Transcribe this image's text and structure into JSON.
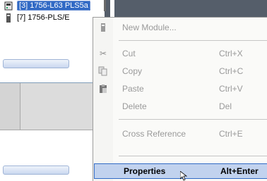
{
  "tree": {
    "items": [
      {
        "label": "[3] 1756-L63 PLS5a"
      },
      {
        "label": "[7] 1756-PLS/E"
      }
    ]
  },
  "context_menu": {
    "items": [
      {
        "label": "New Module...",
        "shortcut": "",
        "icon": "module-icon",
        "disabled": true
      },
      {
        "label": "Cut",
        "shortcut": "Ctrl+X",
        "icon": "scissors-icon",
        "disabled": true
      },
      {
        "label": "Copy",
        "shortcut": "Ctrl+C",
        "icon": "copy-icon",
        "disabled": true
      },
      {
        "label": "Paste",
        "shortcut": "Ctrl+V",
        "icon": "clipboard-icon",
        "disabled": true
      },
      {
        "label": "Delete",
        "shortcut": "Del",
        "icon": "",
        "disabled": true
      },
      {
        "label": "Cross Reference",
        "shortcut": "Ctrl+E",
        "icon": "",
        "disabled": true
      },
      {
        "label": "Properties",
        "shortcut": "Alt+Enter",
        "icon": "",
        "disabled": false,
        "highlighted": true
      }
    ]
  },
  "colors": {
    "selection": "#316ac5",
    "menu_highlight": "#c1d2ee",
    "disabled_text": "#9a9a9a"
  }
}
